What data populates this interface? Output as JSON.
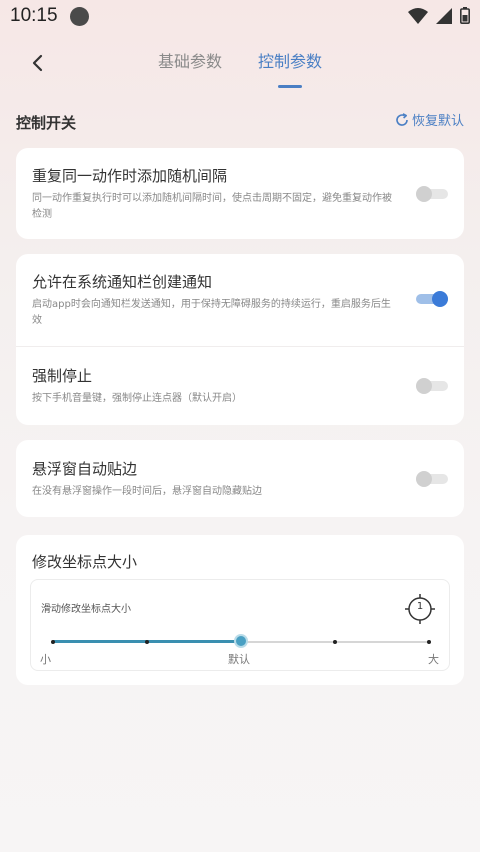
{
  "status": {
    "time": "10:15",
    "icons": [
      "wifi-icon",
      "signal-icon",
      "battery-icon"
    ]
  },
  "nav": {
    "tabs": [
      {
        "label": "基础参数",
        "active": false
      },
      {
        "label": "控制参数",
        "active": true
      }
    ]
  },
  "section": {
    "title": "控制开关",
    "reset_label": "恢复默认"
  },
  "settings": [
    {
      "title": "重复同一动作时添加随机间隔",
      "desc": "同一动作重复执行时可以添加随机间隔时间，使点击周期不固定，避免重复动作被检测",
      "enabled": false
    },
    {
      "title": "允许在系统通知栏创建通知",
      "desc": "启动app时会向通知栏发送通知，用于保持无障碍服务的持续运行，重启服务后生效",
      "enabled": true
    },
    {
      "title": "强制停止",
      "desc": "按下手机音量键，强制停止连点器（默认开启）",
      "enabled": false
    },
    {
      "title": "悬浮窗自动贴边",
      "desc": "在没有悬浮窗操作一段时间后，悬浮窗自动隐藏贴边",
      "enabled": false
    }
  ],
  "size_card": {
    "title": "修改坐标点大小",
    "slider_label": "滑动修改坐标点大小",
    "point_number": "1",
    "slider_value": 0.5,
    "slider_steps": 5,
    "min_label": "小",
    "mid_label": "默认",
    "max_label": "大"
  },
  "colors": {
    "accent": "#4a7fc4",
    "toggle_on": "#3b7bd8",
    "slider": "#3a8fb0"
  }
}
